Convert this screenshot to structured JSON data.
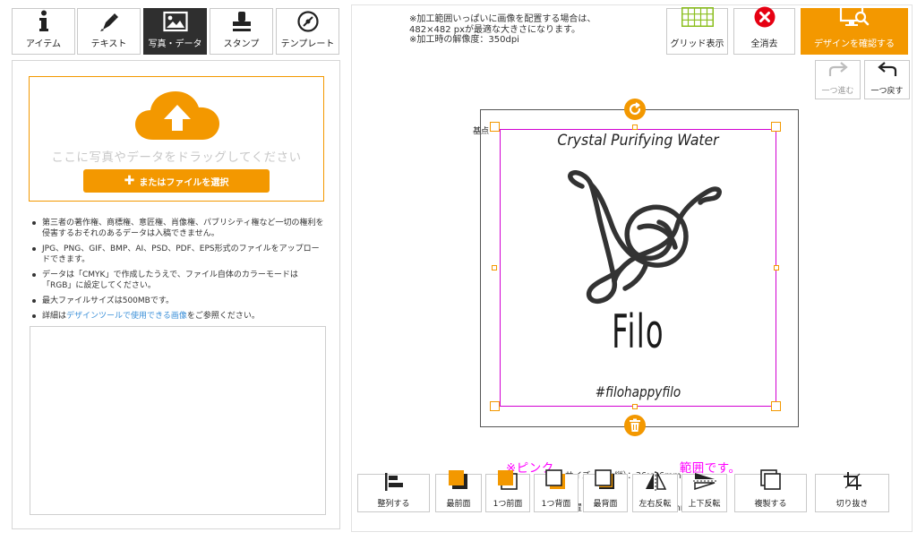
{
  "tabs": [
    {
      "label": "アイテム",
      "icon": "info-icon",
      "active": false
    },
    {
      "label": "テキスト",
      "icon": "pen-icon",
      "active": false
    },
    {
      "label": "写真・データ",
      "icon": "image-icon",
      "active": true
    },
    {
      "label": "スタンプ",
      "icon": "stamp-icon",
      "active": false
    },
    {
      "label": "テンプレート",
      "icon": "template-icon",
      "active": false
    }
  ],
  "upload": {
    "drop_text": "ここに写真やデータをドラッグしてください",
    "file_button": "またはファイルを選択",
    "notes": [
      "第三者の著作権、商標権、意匠権、肖像権、パブリシティ権など一切の権利を侵害するおそれのあるデータは入稿できません。",
      "JPG、PNG、GIF、BMP、AI、PSD、PDF、EPS形式のファイルをアップロードできます。",
      "データは「CMYK」で作成したうえで、ファイル自体のカラーモードは「RGB」に設定してください。",
      "最大ファイルサイズは500MBです。"
    ],
    "details_prefix": "詳細は",
    "details_link": "デザインツールで使用できる画像",
    "details_suffix": "をご参照ください。"
  },
  "print_note": {
    "line1": "※加工範囲いっぱいに画像を配置する場合は、",
    "line2": "482×482 pxが最適な大きさになります。",
    "line3": "※加工時の解像度：350dpi"
  },
  "toolbar": {
    "grid": "グリッド表示",
    "clear_all": "全消去",
    "confirm_design": "デザインを確認する",
    "redo": "一つ進む",
    "undo": "一つ戻す"
  },
  "canvas": {
    "base_label": "基点",
    "brand_top": "Crystal Purifying Water",
    "brand_name": "Filo",
    "brand_hashtag": "#filohappyfilo"
  },
  "size_info": {
    "size": "サイズ（横×縦）：36×36mm",
    "position": "位置　（横，縦）：-1mm，0mm"
  },
  "pink_note": "※ピンク　　　　　　　　　　範囲です。",
  "tools": [
    "整列する",
    "最前面",
    "1つ前面",
    "1つ背面",
    "最背面",
    "左右反転",
    "上下反転",
    "複製する",
    "切り抜き"
  ],
  "colors": {
    "accent": "#f39800",
    "selection": "#d200d2",
    "clear": "#e60012",
    "grid": "#8bbf1e",
    "link": "#3a8fd8"
  }
}
